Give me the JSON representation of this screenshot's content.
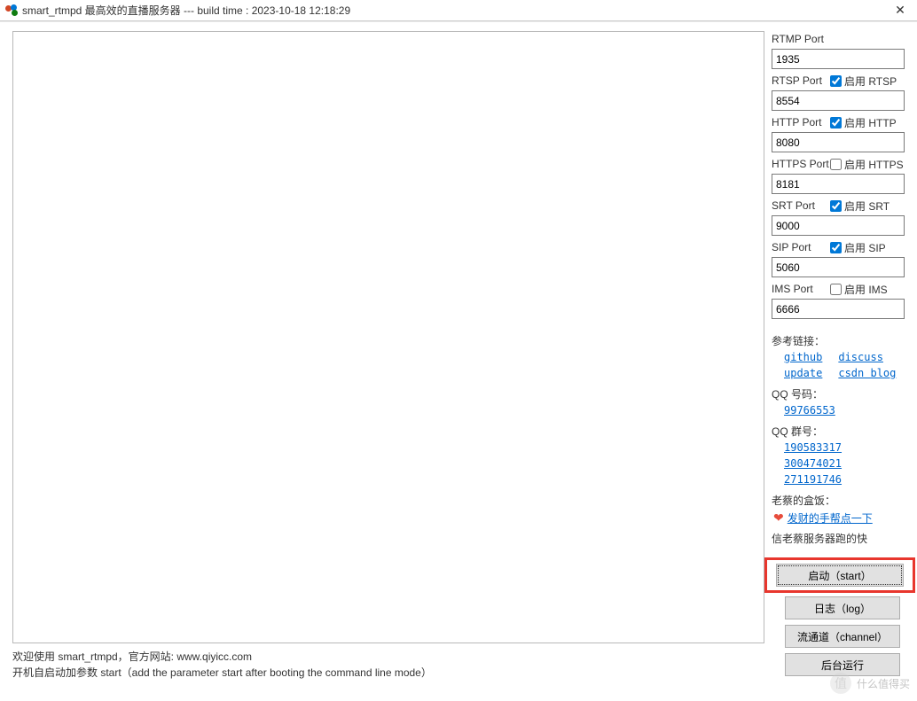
{
  "titlebar": {
    "title": "smart_rtmpd 最高效的直播服务器 --- build time : 2023-10-18 12:18:29",
    "close_symbol": "✕"
  },
  "ports": {
    "items": [
      {
        "label": "RTMP Port",
        "enable_label": "",
        "checked": false,
        "has_check": false,
        "value": "1935"
      },
      {
        "label": "RTSP Port",
        "enable_label": "启用 RTSP",
        "checked": true,
        "has_check": true,
        "value": "8554"
      },
      {
        "label": "HTTP Port",
        "enable_label": "启用 HTTP",
        "checked": true,
        "has_check": true,
        "value": "8080"
      },
      {
        "label": "HTTPS Port",
        "enable_label": "启用 HTTPS",
        "checked": false,
        "has_check": true,
        "value": "8181"
      },
      {
        "label": "SRT Port",
        "enable_label": "启用 SRT",
        "checked": true,
        "has_check": true,
        "value": "9000"
      },
      {
        "label": "SIP Port",
        "enable_label": "启用 SIP",
        "checked": true,
        "has_check": true,
        "value": "5060"
      },
      {
        "label": "IMS Port",
        "enable_label": "启用 IMS",
        "checked": false,
        "has_check": true,
        "value": "6666"
      }
    ]
  },
  "info": {
    "ref_label": "参考链接：",
    "links": {
      "github": "github",
      "update": "update",
      "discuss": "discuss",
      "csdn": "csdn blog"
    },
    "qq_num_label": "QQ 号码：",
    "qq_num": "99766553",
    "qq_group_label": "QQ 群号：",
    "qq_groups": [
      "190583317",
      "300474021",
      "271191746"
    ],
    "donate_label": "老蔡的盒饭：",
    "donate_link": "发财的手帮点一下",
    "slogan": "信老蔡服务器跑的快"
  },
  "buttons": {
    "start": "启动（start）",
    "log": "日志（log）",
    "channel": "流通道（channel）",
    "background": "后台运行"
  },
  "status": {
    "line1": "欢迎使用 smart_rtmpd，官方网站: www.qiyicc.com",
    "line2": "开机自启动加参数 start（add the parameter start after booting the command line mode）"
  },
  "watermark": {
    "icon": "值",
    "text": "什么值得买"
  }
}
